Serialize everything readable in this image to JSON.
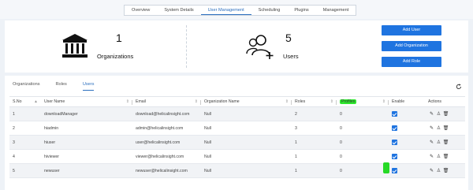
{
  "top_tabs": [
    "Overview",
    "System Details",
    "User Management",
    "Scheduling",
    "Plugins",
    "Management"
  ],
  "stats": {
    "organizations": {
      "count": "1",
      "label": "Organizations",
      "icon": "bank-icon"
    },
    "users": {
      "count": "5",
      "label": "Users",
      "icon": "add-users-icon"
    }
  },
  "buttons": {
    "add_user": "Add User",
    "add_organization": "Add Organization",
    "add_role": "Add Role"
  },
  "sub_tabs": [
    "Organizations",
    "Roles",
    "Users"
  ],
  "table": {
    "headers": [
      "S.No",
      "User Name",
      "Email",
      "Organization Name",
      "Roles",
      "Profiles",
      "Enable",
      "Actions"
    ],
    "rows": [
      {
        "sno": "1",
        "username": "downloadManager",
        "email": "download@helicalinsight.com",
        "org": "Null",
        "roles": "2",
        "profiles": "0",
        "enabled": true
      },
      {
        "sno": "2",
        "username": "hiadmin",
        "email": "admin@helicalinsight.com",
        "org": "Null",
        "roles": "3",
        "profiles": "0",
        "enabled": true
      },
      {
        "sno": "3",
        "username": "hiuser",
        "email": "user@helicalinsight.com",
        "org": "Null",
        "roles": "1",
        "profiles": "0",
        "enabled": true
      },
      {
        "sno": "4",
        "username": "hiviewer",
        "email": "viewer@helicalinsight.com",
        "org": "Null",
        "roles": "1",
        "profiles": "0",
        "enabled": true
      },
      {
        "sno": "5",
        "username": "newuser",
        "email": "newuser@helicalinsight.com",
        "org": "Null",
        "roles": "1",
        "profiles": "0",
        "enabled": true
      }
    ]
  },
  "colors": {
    "accent": "#1f74e0",
    "highlight": "#2ee82e"
  }
}
